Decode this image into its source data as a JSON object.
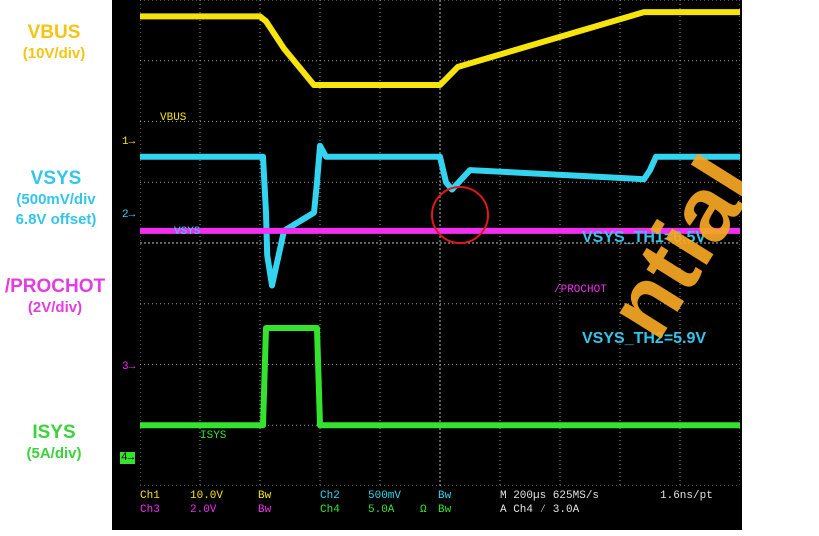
{
  "side_labels": {
    "vbus": {
      "name": "VBUS",
      "scale": "(10V/div)",
      "color": "#f7c413"
    },
    "vsys": {
      "name": "VSYS",
      "scale": "(500mV/div",
      "offset": "6.8V offset)",
      "color": "#33c6ea"
    },
    "prochot": {
      "name": "/PROCHOT",
      "scale": "(2V/div)",
      "color": "#e53ce1"
    },
    "isys": {
      "name": "ISYS",
      "scale": "(5A/div)",
      "color": "#3cd23c"
    }
  },
  "scope": {
    "trace_labels": {
      "vbus": "VBUS",
      "vsys": "VSYS",
      "prochot": "/PROCHOT",
      "isys": "ISYS"
    },
    "thresholds": {
      "th1": "VSYS_TH1=6.5V",
      "th2": "VSYS_TH2=5.9V"
    },
    "channel_markers": {
      "ch1": "1",
      "ch2": "2",
      "ch3": "3",
      "ch4": "4"
    },
    "readout": {
      "ch1": "Ch1",
      "ch1_scale": "10.0V",
      "ch1_bw": "Bw",
      "ch2": "Ch2",
      "ch2_scale": "500mV",
      "ch2_bw": "Bw",
      "ch3": "Ch3",
      "ch3_scale": "2.0V",
      "ch3_bw": "Bw",
      "ch4": "Ch4",
      "ch4_scale": "5.0A",
      "ch4_ohm": "Ω",
      "ch4_bw": "Bw",
      "timebase": "M 200µs 625MS/s",
      "resolution": "1.6ns/pt",
      "trigger": "A  Ch4  ⁄  3.0A"
    },
    "colors": {
      "vbus": "#f7e40a",
      "vsys": "#33d4f0",
      "prochot": "#f22ef0",
      "isys": "#34e32e",
      "grid": "#9a9a9a",
      "circle": "#e01818"
    }
  },
  "watermark": {
    "text": "ntial",
    "color": "#f7a823"
  },
  "chart_data": {
    "type": "line",
    "title": "",
    "x_unit": "div (200µs/div)",
    "xlim": [
      0,
      10
    ],
    "ylim": [
      0,
      8
    ],
    "y_unit": "div",
    "series": [
      {
        "name": "VBUS",
        "x": [
          0,
          2.0,
          2.1,
          2.4,
          2.9,
          3.05,
          5.0,
          5.3,
          8.4,
          10
        ],
        "y": [
          7.73,
          7.73,
          7.65,
          7.2,
          6.6,
          6.6,
          6.6,
          6.9,
          7.8,
          7.8
        ]
      },
      {
        "name": "VSYS",
        "x": [
          0,
          2.05,
          2.1,
          2.12,
          2.2,
          2.4,
          2.9,
          2.95,
          3.0,
          3.1,
          5.0,
          5.1,
          5.2,
          5.5,
          8.4,
          8.5,
          8.6,
          10
        ],
        "y": [
          5.42,
          5.42,
          4.5,
          3.8,
          3.3,
          4.2,
          4.5,
          5.0,
          5.6,
          5.42,
          5.42,
          5.0,
          4.88,
          5.2,
          5.05,
          5.2,
          5.42,
          5.42
        ]
      },
      {
        "name": "/PROCHOT",
        "x": [
          0,
          10
        ],
        "y": [
          4.2,
          4.2
        ]
      },
      {
        "name": "ISYS",
        "x": [
          0,
          2.05,
          2.1,
          2.95,
          3.0,
          10
        ],
        "y": [
          1.0,
          1.0,
          2.6,
          2.6,
          1.0,
          1.0
        ]
      }
    ],
    "annotations": [
      "VSYS_TH1=6.5V",
      "VSYS_TH2=5.9V"
    ]
  }
}
